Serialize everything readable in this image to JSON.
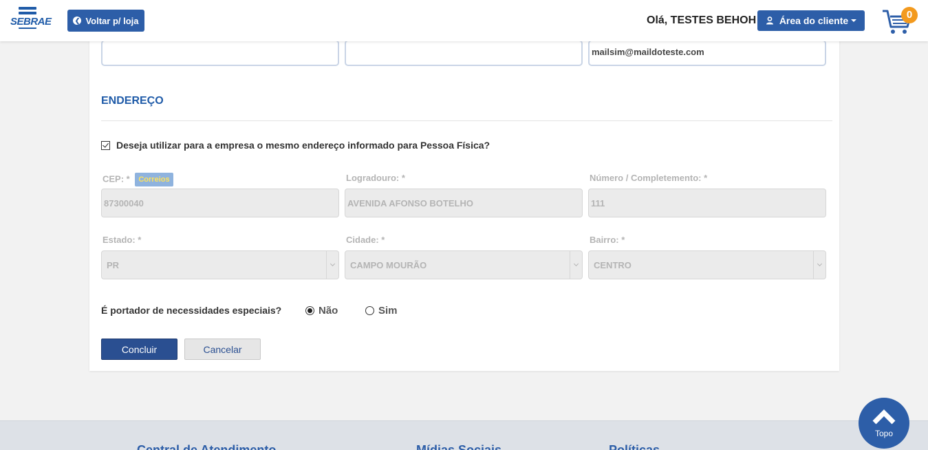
{
  "header": {
    "logo_text": "SEBRAE",
    "back_label": "Voltar p/ loja",
    "greeting": "Olá, TESTES BEHOH",
    "client_area_label": "Área do cliente",
    "cart_count": "0",
    "brand_color": "#2d5ea8",
    "badge_color": "#f39a1e"
  },
  "form": {
    "email_value": "mailsim@maildoteste.com",
    "section_title": "ENDEREÇO",
    "same_address_label": "Deseja utilizar para a empresa o mesmo endereço informado para Pessoa Física?",
    "same_address_checked": true,
    "fields": {
      "cep_label": "CEP: *",
      "correios_label": "Correios",
      "cep_value": "87300040",
      "logradouro_label": "Logradouro: *",
      "logradouro_value": "AVENIDA AFONSO BOTELHO",
      "numero_label": "Número / Completemento: *",
      "numero_value": "111",
      "estado_label": "Estado: *",
      "estado_value": "PR",
      "cidade_label": "Cidade: *",
      "cidade_value": "CAMPO MOURÃO",
      "bairro_label": "Bairro: *",
      "bairro_value": "CENTRO"
    },
    "special_needs_question": "É portador de necessidades especiais?",
    "radio_no": "Não",
    "radio_yes": "Sim",
    "selected": "Não",
    "submit_label": "Concluir",
    "cancel_label": "Cancelar"
  },
  "footer": {
    "col1": "Central de Atendimento",
    "col2": "Mídias Sociais",
    "col3": "Políticas"
  },
  "top_button_label": "Topo"
}
